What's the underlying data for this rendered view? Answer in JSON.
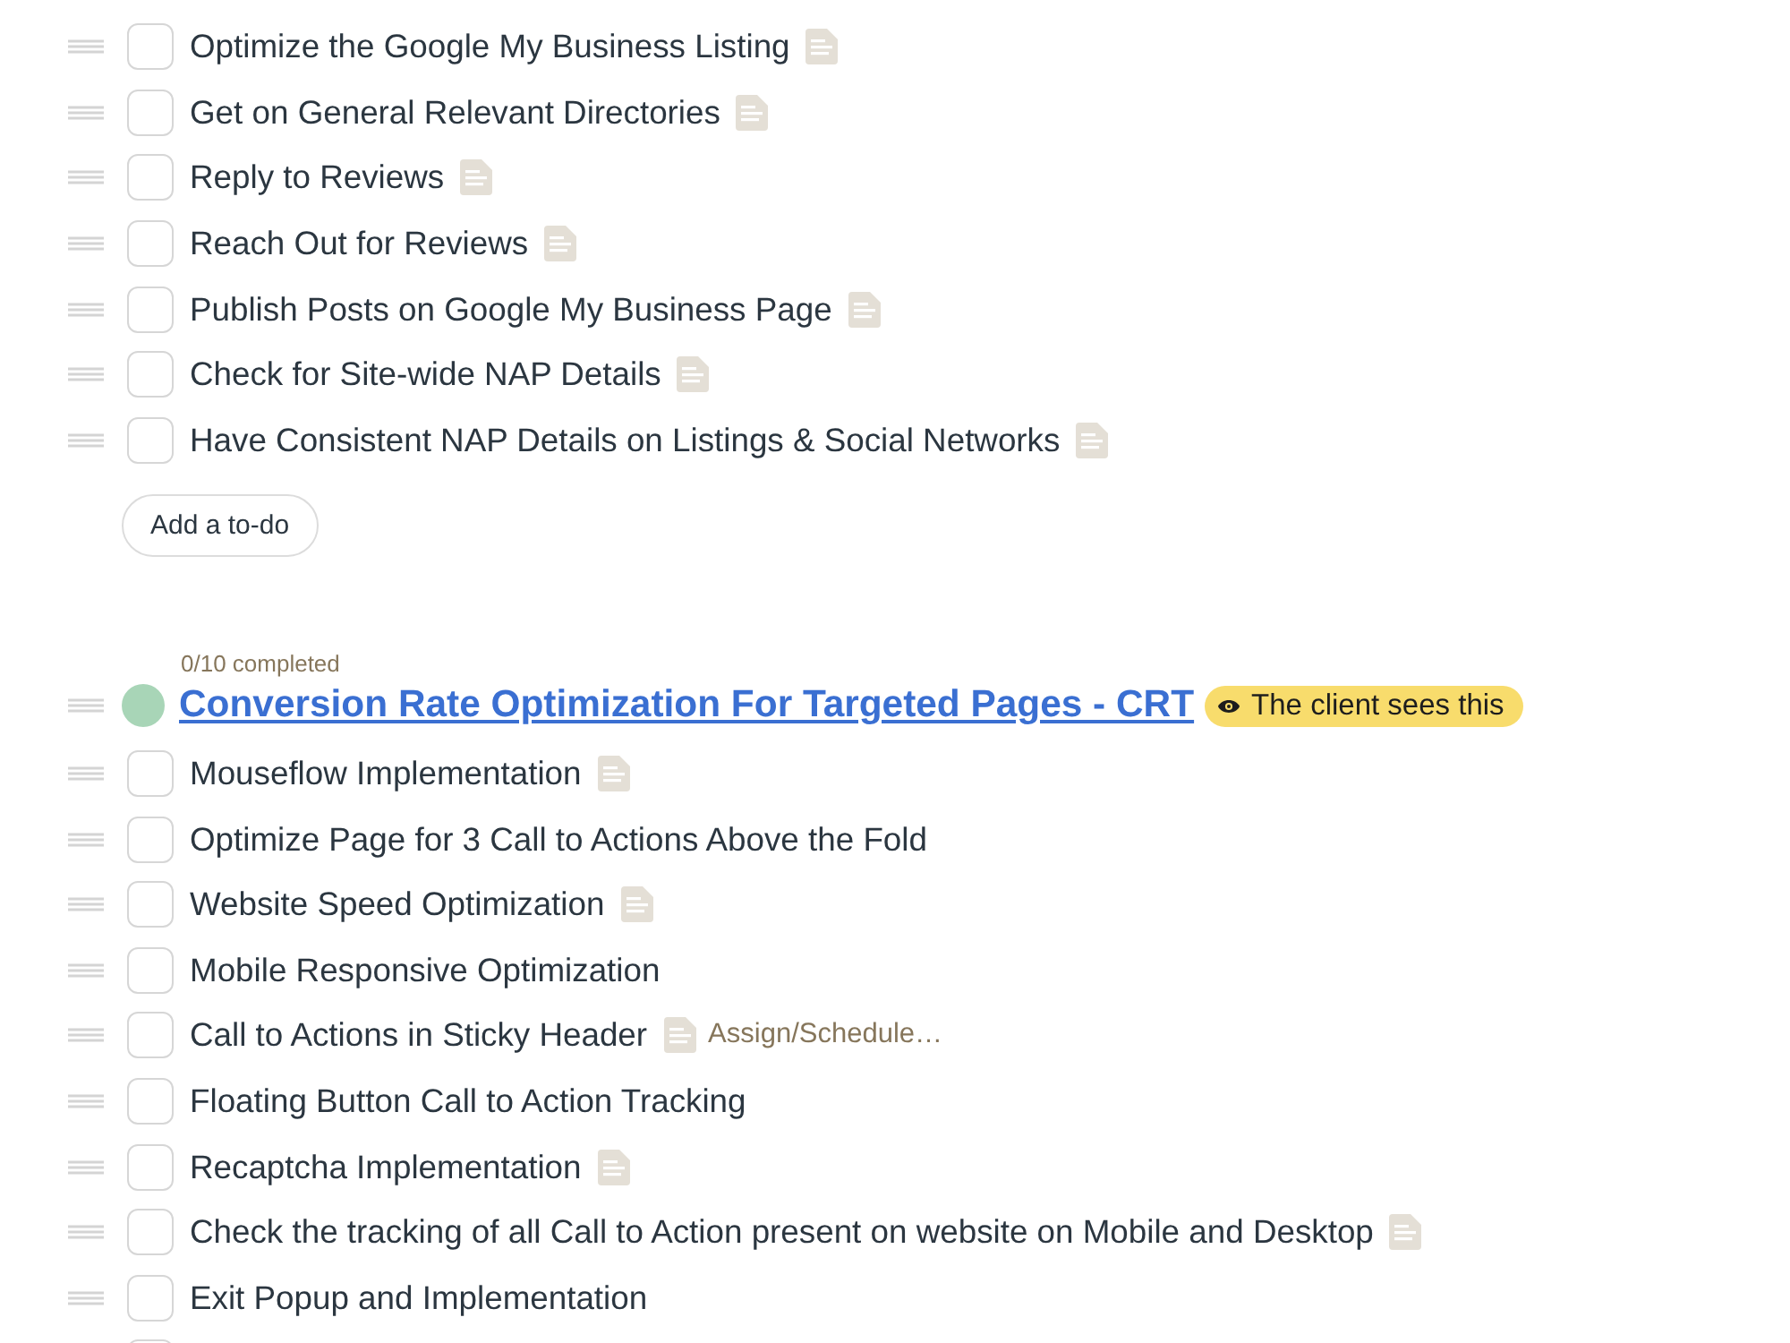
{
  "sections": [
    {
      "items": [
        {
          "title": "Optimize the Google My Business Listing",
          "checked": false,
          "has_notes": true
        },
        {
          "title": "Get on General Relevant Directories",
          "checked": false,
          "has_notes": true
        },
        {
          "title": "Reply to Reviews",
          "checked": false,
          "has_notes": true
        },
        {
          "title": "Reach Out for Reviews",
          "checked": false,
          "has_notes": true
        },
        {
          "title": "Publish Posts on Google My Business Page",
          "checked": false,
          "has_notes": true
        },
        {
          "title": "Check for Site-wide NAP Details",
          "checked": false,
          "has_notes": true
        },
        {
          "title": "Have Consistent NAP Details on Listings & Social Networks",
          "checked": false,
          "has_notes": true
        }
      ],
      "add_button": "Add a to-do"
    },
    {
      "progress": "0/10 completed",
      "color": "#a8d5b7",
      "title": "Conversion Rate Optimization For Targeted Pages - CRT",
      "badge": "The client sees this",
      "items": [
        {
          "title": "Mouseflow Implementation",
          "checked": false,
          "has_notes": true
        },
        {
          "title": "Optimize Page for 3 Call to Actions Above the Fold",
          "checked": false,
          "has_notes": false
        },
        {
          "title": "Website Speed Optimization",
          "checked": false,
          "has_notes": true
        },
        {
          "title": "Mobile Responsive Optimization",
          "checked": false,
          "has_notes": false
        },
        {
          "title": "Call to Actions in Sticky Header",
          "checked": false,
          "has_notes": true,
          "assign": "Assign/Schedule…"
        },
        {
          "title": "Floating Button Call to Action Tracking",
          "checked": false,
          "has_notes": false
        },
        {
          "title": "Recaptcha Implementation",
          "checked": false,
          "has_notes": true
        },
        {
          "title": "Check the tracking of all Call to Action present on website on Mobile and Desktop",
          "checked": false,
          "has_notes": true
        },
        {
          "title": "Exit Popup and Implementation",
          "checked": false,
          "has_notes": false
        },
        {
          "checked": false
        }
      ]
    }
  ]
}
